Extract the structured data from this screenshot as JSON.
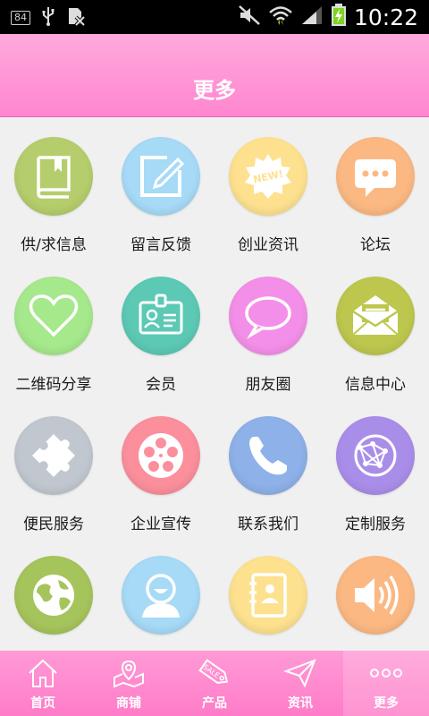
{
  "statusbar": {
    "badge": "84",
    "time": "10:22"
  },
  "header": {
    "title": "更多"
  },
  "grid": {
    "items": [
      {
        "label": "供/求信息",
        "icon": "book-icon",
        "color": "#b5cd6c"
      },
      {
        "label": "留言反馈",
        "icon": "edit-icon",
        "color": "#a6daf6"
      },
      {
        "label": "创业资讯",
        "icon": "new-badge-icon",
        "color": "#fde18f"
      },
      {
        "label": "论坛",
        "icon": "chat-bubble-icon",
        "color": "#fbb882"
      },
      {
        "label": "二维码分享",
        "icon": "heart-icon",
        "color": "#a6e88c"
      },
      {
        "label": "会员",
        "icon": "id-card-icon",
        "color": "#5cc9b4"
      },
      {
        "label": "朋友圈",
        "icon": "speech-bubble-icon",
        "color": "#f38fe8"
      },
      {
        "label": "信息中心",
        "icon": "mail-icon",
        "color": "#bdc74e"
      },
      {
        "label": "便民服务",
        "icon": "puzzle-icon",
        "color": "#c0c7cf"
      },
      {
        "label": "企业宣传",
        "icon": "film-reel-icon",
        "color": "#fb8f9c"
      },
      {
        "label": "联系我们",
        "icon": "phone-icon",
        "color": "#8db1e8"
      },
      {
        "label": "定制服务",
        "icon": "network-globe-icon",
        "color": "#a98ee9"
      },
      {
        "label": "",
        "icon": "globe-icon",
        "color": "#a6c45c"
      },
      {
        "label": "",
        "icon": "smiley-user-icon",
        "color": "#a6daf6"
      },
      {
        "label": "",
        "icon": "address-book-icon",
        "color": "#fde18f"
      },
      {
        "label": "",
        "icon": "speaker-icon",
        "color": "#fbb882"
      }
    ]
  },
  "tabbar": {
    "items": [
      {
        "label": "首页",
        "icon": "home-icon"
      },
      {
        "label": "商铺",
        "icon": "shop-map-icon"
      },
      {
        "label": "产品",
        "icon": "sale-tag-icon"
      },
      {
        "label": "资讯",
        "icon": "paper-plane-icon"
      },
      {
        "label": "更多",
        "icon": "more-dots-icon"
      }
    ],
    "active_index": 4
  }
}
